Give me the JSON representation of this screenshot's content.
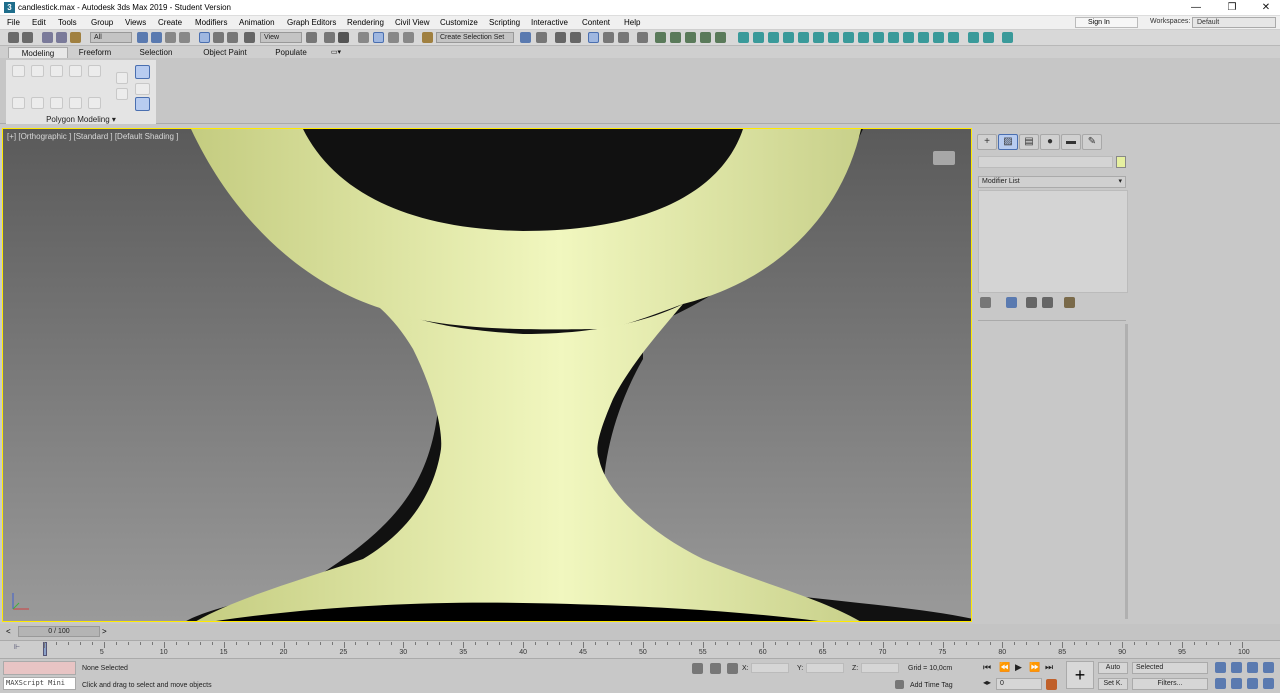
{
  "window": {
    "title": "candlestick.max - Autodesk 3ds Max 2019 - Student Version",
    "app_icon": "3",
    "minimize": "—",
    "maximize": "❐",
    "close": "✕"
  },
  "menu": {
    "items": [
      "File",
      "Edit",
      "Tools",
      "Group",
      "Views",
      "Create",
      "Modifiers",
      "Animation",
      "Graph Editors",
      "Rendering",
      "Civil View",
      "Customize",
      "Scripting",
      "Interactive",
      "Content",
      "Help"
    ],
    "sign_in": "Sign In",
    "workspaces_label": "Workspaces:",
    "workspaces_value": "Default"
  },
  "toolbar": {
    "filter_select": "All",
    "view_select": "View",
    "selection_set": "Create Selection Set"
  },
  "ribbon": {
    "tabs": [
      "Modeling",
      "Freeform",
      "Selection",
      "Object Paint",
      "Populate"
    ],
    "panel_label": "Polygon Modeling ▾"
  },
  "viewport": {
    "label": "[+] [Orthographic ] [Standard ] [Default Shading ]",
    "object_color": "#e8f0a8",
    "border_color": "#ffea00"
  },
  "command_panel": {
    "modifier_list": "Modifier List"
  },
  "timeline": {
    "frame_display": "0 / 100",
    "ticks": [
      "5",
      "10",
      "15",
      "20",
      "25",
      "30",
      "35",
      "40",
      "45",
      "50",
      "55",
      "60",
      "65",
      "70",
      "75",
      "80",
      "85",
      "90",
      "95",
      "100"
    ]
  },
  "status": {
    "maxscript": "MAXScript Mini",
    "selection": "None Selected",
    "prompt": "Click and drag to select and move objects",
    "x_label": "X:",
    "y_label": "Y:",
    "z_label": "Z:",
    "grid": "Grid = 10,0cm",
    "add_time_tag": "Add Time Tag",
    "auto": "Auto",
    "set_key": "Set K.",
    "selected": "Selected",
    "filters": "Filters...",
    "frame_value": "0"
  }
}
